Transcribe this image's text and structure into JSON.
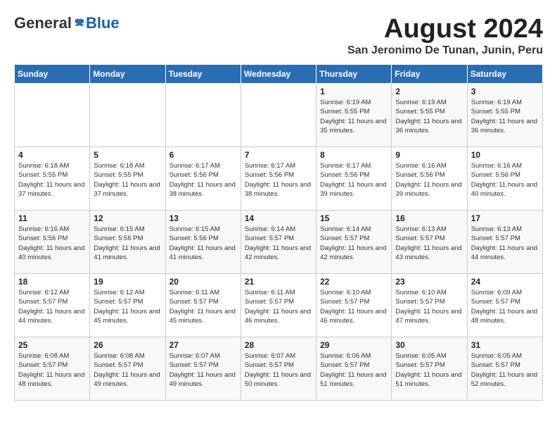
{
  "logo": {
    "general": "General",
    "blue": "Blue"
  },
  "title": "August 2024",
  "location": "San Jeronimo De Tunan, Junin, Peru",
  "days_of_week": [
    "Sunday",
    "Monday",
    "Tuesday",
    "Wednesday",
    "Thursday",
    "Friday",
    "Saturday"
  ],
  "weeks": [
    [
      {
        "day": "",
        "detail": ""
      },
      {
        "day": "",
        "detail": ""
      },
      {
        "day": "",
        "detail": ""
      },
      {
        "day": "",
        "detail": ""
      },
      {
        "day": "1",
        "detail": "Sunrise: 6:19 AM\nSunset: 5:55 PM\nDaylight: 11 hours\nand 35 minutes."
      },
      {
        "day": "2",
        "detail": "Sunrise: 6:19 AM\nSunset: 5:55 PM\nDaylight: 11 hours\nand 36 minutes."
      },
      {
        "day": "3",
        "detail": "Sunrise: 6:19 AM\nSunset: 5:55 PM\nDaylight: 11 hours\nand 36 minutes."
      }
    ],
    [
      {
        "day": "4",
        "detail": "Sunrise: 6:18 AM\nSunset: 5:55 PM\nDaylight: 11 hours\nand 37 minutes."
      },
      {
        "day": "5",
        "detail": "Sunrise: 6:18 AM\nSunset: 5:55 PM\nDaylight: 11 hours\nand 37 minutes."
      },
      {
        "day": "6",
        "detail": "Sunrise: 6:17 AM\nSunset: 5:56 PM\nDaylight: 11 hours\nand 38 minutes."
      },
      {
        "day": "7",
        "detail": "Sunrise: 6:17 AM\nSunset: 5:56 PM\nDaylight: 11 hours\nand 38 minutes."
      },
      {
        "day": "8",
        "detail": "Sunrise: 6:17 AM\nSunset: 5:56 PM\nDaylight: 11 hours\nand 39 minutes."
      },
      {
        "day": "9",
        "detail": "Sunrise: 6:16 AM\nSunset: 5:56 PM\nDaylight: 11 hours\nand 39 minutes."
      },
      {
        "day": "10",
        "detail": "Sunrise: 6:16 AM\nSunset: 5:56 PM\nDaylight: 11 hours\nand 40 minutes."
      }
    ],
    [
      {
        "day": "11",
        "detail": "Sunrise: 6:16 AM\nSunset: 5:56 PM\nDaylight: 11 hours\nand 40 minutes."
      },
      {
        "day": "12",
        "detail": "Sunrise: 6:15 AM\nSunset: 5:56 PM\nDaylight: 11 hours\nand 41 minutes."
      },
      {
        "day": "13",
        "detail": "Sunrise: 6:15 AM\nSunset: 5:56 PM\nDaylight: 11 hours\nand 41 minutes."
      },
      {
        "day": "14",
        "detail": "Sunrise: 6:14 AM\nSunset: 5:57 PM\nDaylight: 11 hours\nand 42 minutes."
      },
      {
        "day": "15",
        "detail": "Sunrise: 6:14 AM\nSunset: 5:57 PM\nDaylight: 11 hours\nand 42 minutes."
      },
      {
        "day": "16",
        "detail": "Sunrise: 6:13 AM\nSunset: 5:57 PM\nDaylight: 11 hours\nand 43 minutes."
      },
      {
        "day": "17",
        "detail": "Sunrise: 6:13 AM\nSunset: 5:57 PM\nDaylight: 11 hours\nand 44 minutes."
      }
    ],
    [
      {
        "day": "18",
        "detail": "Sunrise: 6:12 AM\nSunset: 5:57 PM\nDaylight: 11 hours\nand 44 minutes."
      },
      {
        "day": "19",
        "detail": "Sunrise: 6:12 AM\nSunset: 5:57 PM\nDaylight: 11 hours\nand 45 minutes."
      },
      {
        "day": "20",
        "detail": "Sunrise: 6:11 AM\nSunset: 5:57 PM\nDaylight: 11 hours\nand 45 minutes."
      },
      {
        "day": "21",
        "detail": "Sunrise: 6:11 AM\nSunset: 5:57 PM\nDaylight: 11 hours\nand 46 minutes."
      },
      {
        "day": "22",
        "detail": "Sunrise: 6:10 AM\nSunset: 5:57 PM\nDaylight: 11 hours\nand 46 minutes."
      },
      {
        "day": "23",
        "detail": "Sunrise: 6:10 AM\nSunset: 5:57 PM\nDaylight: 11 hours\nand 47 minutes."
      },
      {
        "day": "24",
        "detail": "Sunrise: 6:09 AM\nSunset: 5:57 PM\nDaylight: 11 hours\nand 48 minutes."
      }
    ],
    [
      {
        "day": "25",
        "detail": "Sunrise: 6:08 AM\nSunset: 5:57 PM\nDaylight: 11 hours\nand 48 minutes."
      },
      {
        "day": "26",
        "detail": "Sunrise: 6:08 AM\nSunset: 5:57 PM\nDaylight: 11 hours\nand 49 minutes."
      },
      {
        "day": "27",
        "detail": "Sunrise: 6:07 AM\nSunset: 5:57 PM\nDaylight: 11 hours\nand 49 minutes."
      },
      {
        "day": "28",
        "detail": "Sunrise: 6:07 AM\nSunset: 5:57 PM\nDaylight: 11 hours\nand 50 minutes."
      },
      {
        "day": "29",
        "detail": "Sunrise: 6:06 AM\nSunset: 5:57 PM\nDaylight: 11 hours\nand 51 minutes."
      },
      {
        "day": "30",
        "detail": "Sunrise: 6:05 AM\nSunset: 5:57 PM\nDaylight: 11 hours\nand 51 minutes."
      },
      {
        "day": "31",
        "detail": "Sunrise: 6:05 AM\nSunset: 5:57 PM\nDaylight: 11 hours\nand 52 minutes."
      }
    ]
  ]
}
